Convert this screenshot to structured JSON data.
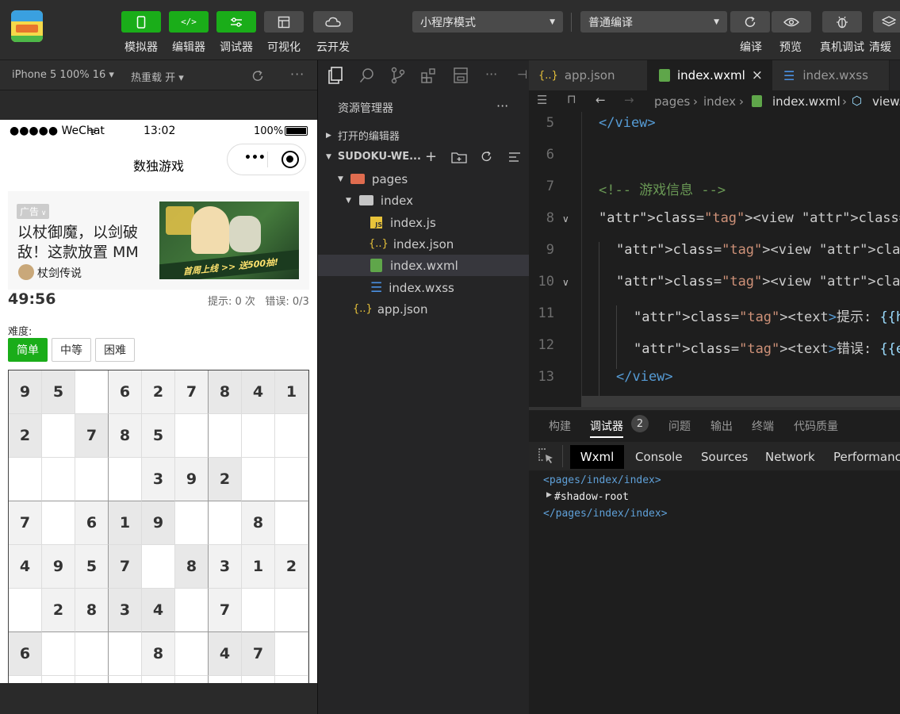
{
  "toolbar": {
    "buttons": [
      {
        "label": "模拟器",
        "icon": "phone-icon"
      },
      {
        "label": "编辑器",
        "icon": "code-icon"
      },
      {
        "label": "调试器",
        "icon": "debug-sliders-icon"
      },
      {
        "label": "可视化",
        "icon": "layout-icon"
      },
      {
        "label": "云开发",
        "icon": "cloud-icon"
      }
    ],
    "mode_select": "小程序模式",
    "compile_select": "普通编译",
    "right_buttons": [
      {
        "label": "编译",
        "icon": "refresh-icon"
      },
      {
        "label": "预览",
        "icon": "eye-icon"
      },
      {
        "label": "真机调试",
        "icon": "bug-icon"
      },
      {
        "label": "清缓",
        "icon": "layers-icon"
      }
    ]
  },
  "simulator": {
    "device": "iPhone 5 100% 16 ▾",
    "hot_reload": "热重载 开 ▾",
    "status": {
      "carrier": "●●●●● WeChat",
      "time": "13:02",
      "battery": "100%"
    },
    "nav_title": "数独游戏",
    "ad": {
      "badge": "广告",
      "text": "以杖御魔，以剑破敌！这款放置 MM",
      "brand": "杖剑传说",
      "banner_line1": "首周上线",
      "banner_line2": "送500抽!"
    },
    "game": {
      "timer": "49:56",
      "stats": "提示: 0 次   错误: 0/3",
      "difficulty_label": "难度:",
      "difficulty": [
        "简单",
        "中等",
        "困难"
      ],
      "board": [
        [
          "9",
          "5",
          "",
          "6",
          "2",
          "7",
          "8",
          "4",
          "1"
        ],
        [
          "2",
          "",
          "7",
          "8",
          "5",
          "",
          "",
          "",
          ""
        ],
        [
          "",
          "",
          "",
          "",
          "3",
          "9",
          "2",
          "",
          ""
        ],
        [
          "7",
          "",
          "6",
          "1",
          "9",
          "",
          "",
          "8",
          ""
        ],
        [
          "4",
          "9",
          "5",
          "7",
          "",
          "8",
          "3",
          "1",
          "2"
        ],
        [
          "",
          "2",
          "8",
          "3",
          "4",
          "",
          "7",
          "",
          ""
        ],
        [
          "6",
          "",
          "",
          "",
          "8",
          "",
          "4",
          "7",
          ""
        ],
        [
          "",
          "",
          "",
          "",
          "",
          "",
          "",
          "",
          ""
        ]
      ]
    }
  },
  "explorer": {
    "title": "资源管理器",
    "open_editors": "打开的编辑器",
    "project": "SUDOKU-WE...",
    "tree": [
      "pages",
      "index",
      "index.js",
      "index.json",
      "index.wxml",
      "index.wxss",
      "app.json"
    ]
  },
  "editor": {
    "tabs": [
      "app.json",
      "index.wxml",
      "index.wxss"
    ],
    "breadcrumb": [
      "pages",
      "index",
      "index.wxml",
      "view."
    ],
    "lines": [
      {
        "n": "5",
        "code": "</view>"
      },
      {
        "n": "6",
        "code": ""
      },
      {
        "n": "7",
        "code": "<!-- 游戏信息 -->"
      },
      {
        "n": "8",
        "code": "<view class=\"game-info\">"
      },
      {
        "n": "9",
        "code": "<view class=\"timer\">{{timer}}</vi"
      },
      {
        "n": "10",
        "code": "<view class=\"stats\">"
      },
      {
        "n": "11",
        "code": "<text>提示: {{hintCount}} 次</te"
      },
      {
        "n": "12",
        "code": "<text>错误: {{errorCount}}/{{ma"
      },
      {
        "n": "13",
        "code": "</view>"
      }
    ]
  },
  "panel": {
    "tabs": [
      "构建",
      "调试器",
      "问题",
      "输出",
      "终端",
      "代码质量"
    ],
    "badge": "2",
    "devtabs": [
      "Wxml",
      "Console",
      "Sources",
      "Network",
      "Performance"
    ],
    "dom": [
      "<pages/index/index>",
      "#shadow-root",
      "</pages/index/index>"
    ]
  },
  "colors": {
    "accent": "#1aad19",
    "tag": "#569cd6",
    "attr": "#9cdcfe",
    "string": "#ce9178",
    "comment": "#6a9955"
  }
}
